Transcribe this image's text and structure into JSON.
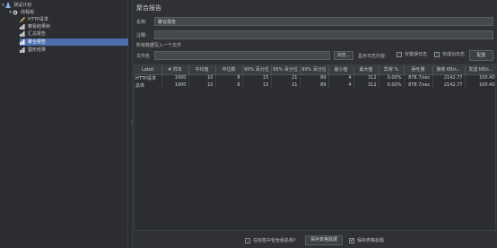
{
  "tree": {
    "items": [
      {
        "label": "测试计划",
        "icon": "test-plan-icon"
      },
      {
        "label": "线程组",
        "icon": "thread-group-gear-icon"
      },
      {
        "label": "HTTP请求",
        "icon": "http-sampler-pen-icon"
      },
      {
        "label": "察看结果树",
        "icon": "listener-chart-icon"
      },
      {
        "label": "汇总报告",
        "icon": "listener-chart-icon"
      },
      {
        "label": "聚合报告",
        "icon": "listener-chart-icon",
        "selected": true
      },
      {
        "label": "图形结果",
        "icon": "listener-chart-icon"
      }
    ]
  },
  "panel": {
    "title": "聚合报告",
    "name_label": "名称:",
    "name_value": "聚合报告",
    "comment_label": "注释:",
    "comment_value": "",
    "section_label": "所有数据写入一个文件",
    "filename_label": "文件名",
    "filename_value": "",
    "browse_button": "浏览...",
    "log_display_label": "显示日志内容:",
    "errors_only_label": "仅错误日志",
    "success_only_label": "仅成功日志",
    "configure_button": "配置"
  },
  "table": {
    "headers": [
      "Label",
      "# 样本",
      "平均值",
      "中位数",
      "90% 百分位",
      "95% 百分位",
      "99% 百分位",
      "最小值",
      "最大值",
      "异常 %",
      "吞吐量",
      "接收 KB/s...",
      "发送 KB/s..."
    ],
    "rows": [
      [
        "HTTP请求",
        "1000",
        "10",
        "8",
        "15",
        "21",
        "89",
        "4",
        "312",
        "0.00%",
        "878.7/sec",
        "2142.77",
        "100.40"
      ],
      [
        "总体",
        "1000",
        "10",
        "8",
        "15",
        "21",
        "89",
        "4",
        "312",
        "0.00%",
        "878.7/sec",
        "2142.77",
        "100.40"
      ]
    ]
  },
  "footer": {
    "include_group_label": "在标签中包含组名称?",
    "include_group_checked": false,
    "save_table_button": "保存表格数据",
    "save_header_label": "保存表格标题",
    "save_header_checked": true
  },
  "colors": {
    "selected_row": "#4b6eaf",
    "background": "#2b2d30",
    "panel": "#2f3134",
    "input": "#45494a"
  }
}
